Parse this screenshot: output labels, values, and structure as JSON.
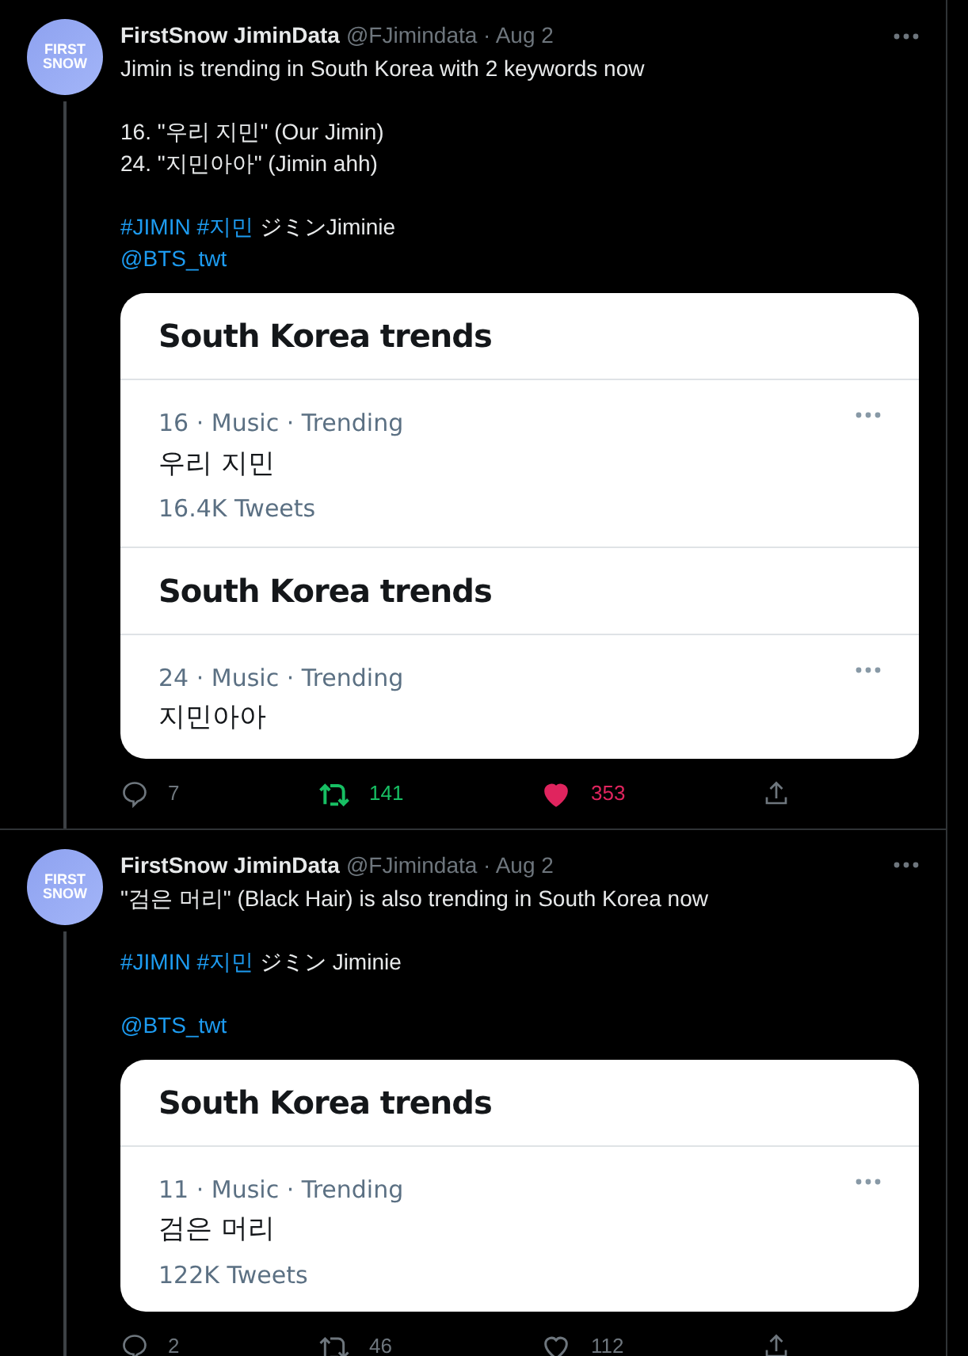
{
  "tweets": [
    {
      "name": "FirstSnow JiminData",
      "byline": "@FJimindata · Aug 2",
      "avatar_text": [
        "FIRST",
        "SNOW"
      ],
      "body": [
        [
          [
            {
              "kind": "text",
              "text": "Jimin is trending in South Korea with 2 keywords now"
            }
          ]
        ],
        [
          [
            {
              "kind": "text",
              "text": "16. \"우리 지민\" (Our Jimin)"
            }
          ],
          [
            {
              "kind": "text",
              "text": "24. \"지민아아\" (Jimin ahh)"
            }
          ]
        ],
        [
          [
            {
              "kind": "link",
              "text": "#JIMIN"
            },
            {
              "kind": "link",
              "text": "#지민"
            },
            {
              "kind": "text",
              "text": " ジミンJiminie"
            }
          ],
          [
            {
              "kind": "link",
              "text": "@BTS_twt"
            }
          ]
        ]
      ],
      "card": [
        {
          "kind": "header",
          "title": "South Korea trends"
        },
        {
          "kind": "trend",
          "meta": "16 · Music · Trending",
          "topic": "우리 지민",
          "count": "16.4K Tweets"
        },
        {
          "kind": "header",
          "title": "South Korea trends"
        },
        {
          "kind": "trend",
          "meta": "24 · Music · Trending",
          "topic": "지민아아"
        }
      ],
      "replies": "7",
      "retweets": "141",
      "likes": "353",
      "retweeted": true,
      "liked": true
    },
    {
      "name": "FirstSnow JiminData",
      "byline": "@FJimindata · Aug 2",
      "avatar_text": [
        "FIRST",
        "SNOW"
      ],
      "body": [
        [
          [
            {
              "kind": "text",
              "text": "\"검은 머리\" (Black Hair) is also trending in South Korea now"
            }
          ]
        ],
        [
          [
            {
              "kind": "link",
              "text": "#JIMIN"
            },
            {
              "kind": "link",
              "text": "#지민"
            },
            {
              "kind": "text",
              "text": " ジミン Jiminie"
            }
          ]
        ],
        [
          [
            {
              "kind": "link",
              "text": "@BTS_twt"
            }
          ]
        ]
      ],
      "card": [
        {
          "kind": "header",
          "title": "South Korea trends"
        },
        {
          "kind": "trend",
          "meta": "11 · Music · Trending",
          "topic": "검은 머리",
          "count": "122K Tweets"
        }
      ],
      "replies": "2",
      "retweets": "46",
      "likes": "112",
      "retweeted": false,
      "liked": false
    }
  ]
}
